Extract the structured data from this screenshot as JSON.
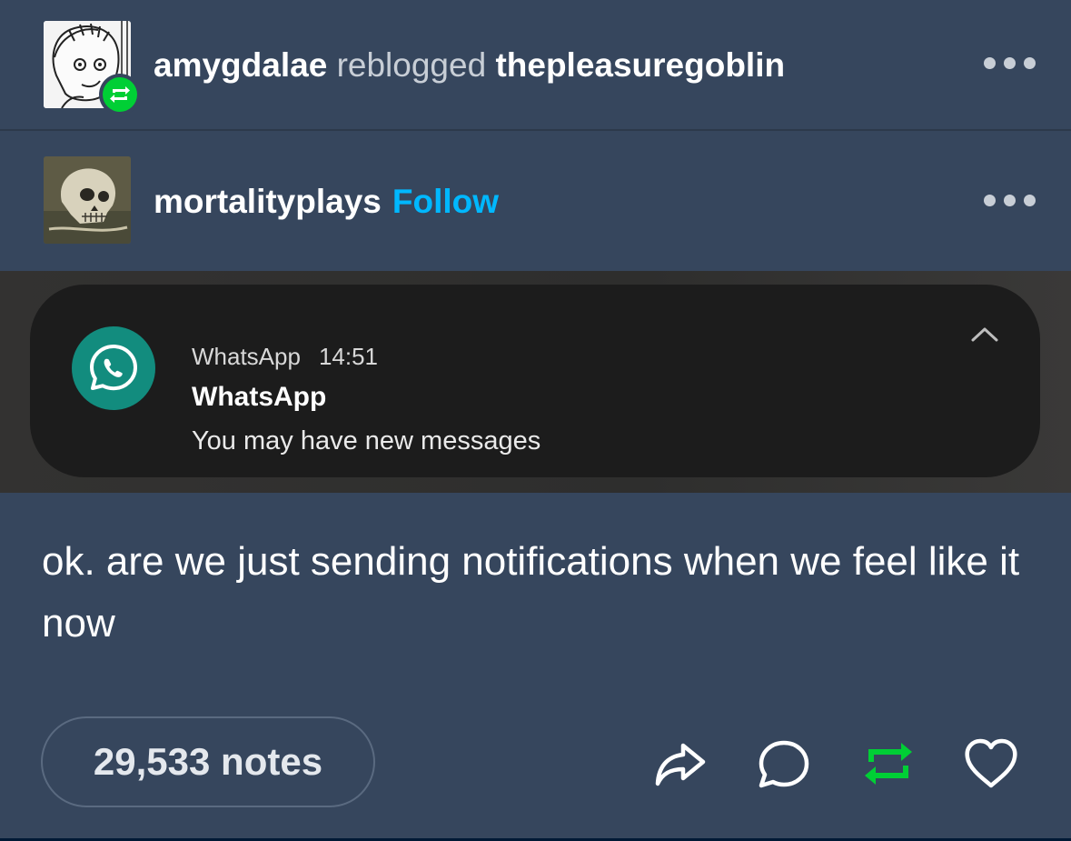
{
  "reblog_header": {
    "reblogger": "amygdalae",
    "action": "reblogged",
    "source": "thepleasuregoblin"
  },
  "post_author": {
    "username": "mortalityplays",
    "follow_label": "Follow"
  },
  "notification": {
    "app_name": "WhatsApp",
    "time": "14:51",
    "title": "WhatsApp",
    "body": "You may have new messages"
  },
  "post_body": {
    "text": "ok. are we just sending notifications when we feel like it now"
  },
  "footer": {
    "notes_label": "29,533 notes"
  },
  "colors": {
    "background": "#36465d",
    "follow_link": "#00b8ff",
    "reblog_green": "#00cf35",
    "whatsapp_green": "#128c7e"
  },
  "icons": {
    "reblog_badge": "reblog-icon",
    "menu": "more-dots-icon",
    "notification_app": "whatsapp-icon",
    "expand": "chevron-up-icon",
    "share": "share-icon",
    "reply": "reply-icon",
    "reblog": "reblog-icon",
    "like": "heart-icon"
  }
}
